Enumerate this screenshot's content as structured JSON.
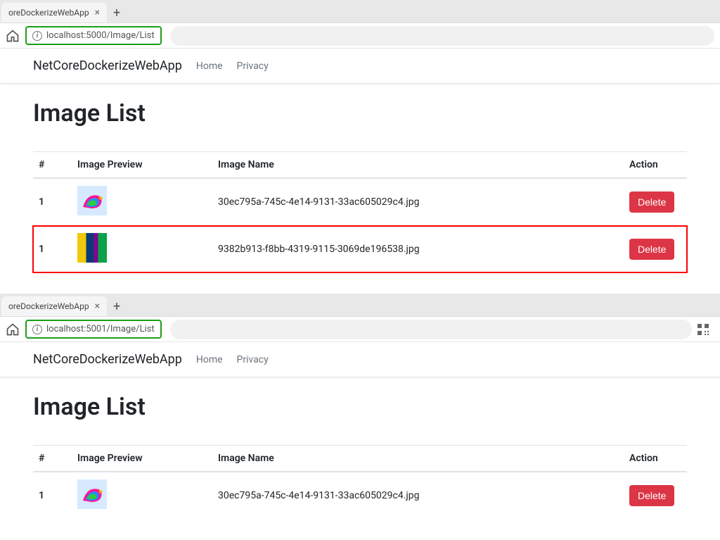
{
  "windows": [
    {
      "tab_title": "oreDockerizeWebApp",
      "url": "localhost:5000/Image/List",
      "url_highlighted": true,
      "show_qr": false,
      "navbar": {
        "brand": "NetCoreDockerizeWebApp",
        "links": [
          "Home",
          "Privacy"
        ]
      },
      "page_title": "Image List",
      "table": {
        "headers": [
          "#",
          "Image Preview",
          "Image Name",
          "Action"
        ],
        "rows": [
          {
            "num": "1",
            "thumb": "bird",
            "name": "30ec795a-745c-4e14-9131-33ac605029c4.jpg",
            "action": "Delete",
            "highlighted": false
          },
          {
            "num": "1",
            "thumb": "alt",
            "name": "9382b913-f8bb-4319-9115-3069de196538.jpg",
            "action": "Delete",
            "highlighted": true
          }
        ]
      }
    },
    {
      "tab_title": "oreDockerizeWebApp",
      "url": "localhost:5001/Image/List",
      "url_highlighted": true,
      "show_qr": true,
      "navbar": {
        "brand": "NetCoreDockerizeWebApp",
        "links": [
          "Home",
          "Privacy"
        ]
      },
      "page_title": "Image List",
      "table": {
        "headers": [
          "#",
          "Image Preview",
          "Image Name",
          "Action"
        ],
        "rows": [
          {
            "num": "1",
            "thumb": "bird",
            "name": "30ec795a-745c-4e14-9131-33ac605029c4.jpg",
            "action": "Delete",
            "highlighted": false
          }
        ]
      }
    }
  ]
}
